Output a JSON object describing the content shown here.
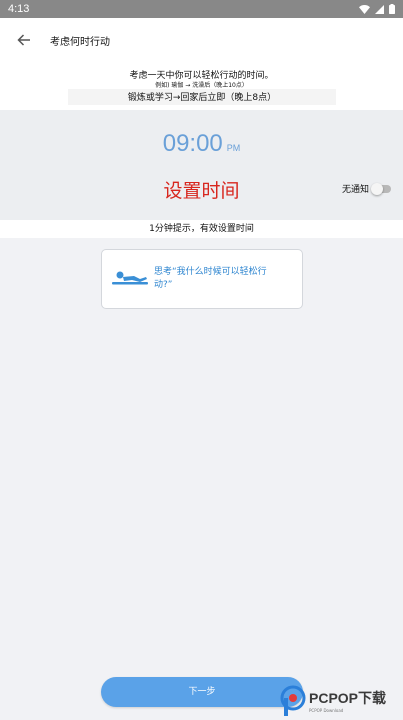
{
  "status_bar": {
    "time": "4:13"
  },
  "app_bar": {
    "title": "考虑何时行动"
  },
  "intro": {
    "line1": "考虑一天中你可以轻松行动的时间。",
    "line2": "例如) 瑜伽 → 洗澡后（晚上10点）",
    "line3": "锻炼或学习→回家后立即（晚上8点）"
  },
  "time": {
    "value": "09:00",
    "ampm": "PM"
  },
  "set_time_label": "设置时间",
  "notify_label": "无通知",
  "hint": "1分钟提示，有效设置时间",
  "think_card": {
    "line1": "思考“我什么时候可以轻松行",
    "line2": "动?”"
  },
  "next_button": "下一步",
  "watermark": {
    "brand": "PCPOP下载",
    "sub": "PCPOP Download"
  },
  "colors": {
    "accent_blue": "#5aa2e8",
    "time_blue": "#6aa0d8",
    "red": "#d8261e",
    "card_text": "#2f86d0"
  }
}
